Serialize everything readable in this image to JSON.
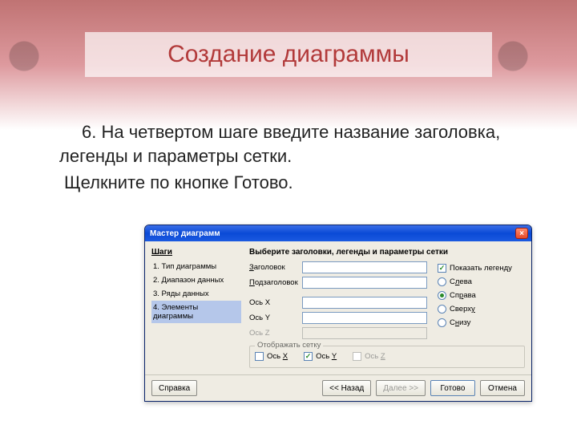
{
  "page": {
    "title": "Создание диаграммы",
    "step_text": "6. На четвертом шаге введите название заголовка, легенды и параметры сетки.",
    "step_text2": "Щелкните по кнопке Готово."
  },
  "dialog": {
    "title": "Мастер диаграмм",
    "close_icon": "×",
    "steps_heading": "Шаги",
    "steps": [
      "1. Тип диаграммы",
      "2. Диапазон данных",
      "3. Ряды данных",
      "4. Элементы диаграммы"
    ],
    "active_step_index": 3,
    "right_heading": "Выберите заголовки, легенды и параметры сетки",
    "fields": {
      "title_label_pre": "З",
      "title_label": "аголовок",
      "subtitle_label_pre": "П",
      "subtitle_label": "одзаголовок",
      "axis_x_pre": "",
      "axis_x": "Ось X",
      "axis_y_pre": "",
      "axis_y": "Ось Y",
      "axis_z_pre": "",
      "axis_z": "Ось Z"
    },
    "legend": {
      "show_label": "Показать легенду",
      "show_checked": true,
      "options": [
        {
          "label": "Слева",
          "checked": false,
          "u": "л"
        },
        {
          "label": "Справа",
          "checked": true,
          "u": "р"
        },
        {
          "label": "Сверху",
          "checked": false,
          "u": "у"
        },
        {
          "label": "Снизу",
          "checked": false,
          "u": "н"
        }
      ]
    },
    "grid": {
      "legend": "Отображать сетку",
      "x_label": "Ось X",
      "x_u": "X",
      "x_checked": false,
      "y_label": "Ось Y",
      "y_u": "Y",
      "y_checked": true,
      "z_label": "Ось Z",
      "z_u": "Z",
      "z_checked": false,
      "z_disabled": true
    },
    "buttons": {
      "help": "Справка",
      "back": "<< Назад",
      "next": "Далее >>",
      "finish": "Готово",
      "cancel": "Отмена"
    }
  }
}
